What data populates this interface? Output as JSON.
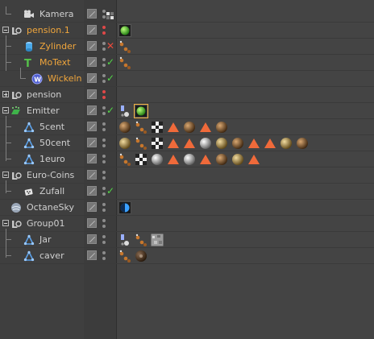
{
  "colors": {
    "orange_label": "#f0a63c",
    "normal_label": "#d0d0d0",
    "red_dot": "#e04848",
    "grey_dot": "#8c8c8c",
    "check": "#52d648",
    "cross": "#e84b3c"
  },
  "rows": [
    {
      "name": "Kamera",
      "icon": "camera-icon",
      "label_color": "normal",
      "vis": [
        "grey",
        "grey"
      ],
      "status": "grid",
      "tags": []
    },
    {
      "name": "pension.1",
      "icon": "null-object-icon",
      "label_color": "orange",
      "vis": [
        "red",
        "red"
      ],
      "status": "",
      "tags": [
        "green-material-icon"
      ]
    },
    {
      "name": "Zylinder",
      "icon": "cylinder-icon",
      "label_color": "orange",
      "vis": [
        "grey",
        "grey"
      ],
      "status": "cross",
      "tags": [
        "texture-dots-icon"
      ]
    },
    {
      "name": "MoText",
      "icon": "motext-icon",
      "label_color": "orange",
      "vis": [
        "grey",
        "grey"
      ],
      "status": "check",
      "tags": [
        "texture-dots-icon"
      ]
    },
    {
      "name": "Wickeln",
      "icon": "wrap-deformer-icon",
      "label_color": "orange",
      "vis": [
        "grey",
        "grey"
      ],
      "status": "check",
      "tags": []
    },
    {
      "name": "pension",
      "icon": "null-object-icon",
      "label_color": "normal",
      "vis": [
        "red",
        "red"
      ],
      "status": "",
      "tags": []
    },
    {
      "name": "Emitter",
      "icon": "emitter-icon",
      "label_color": "normal",
      "vis": [
        "grey",
        "grey"
      ],
      "status": "check",
      "tags": [
        "particle-icon",
        "green-material-icon"
      ]
    },
    {
      "name": "5cent",
      "icon": "cloner-icon",
      "label_color": "normal",
      "vis": [
        "grey",
        "grey"
      ],
      "status": "",
      "tags": [
        "brown-sphere-icon",
        "texture-dots-icon",
        "checker-icon",
        "orange-triangle-icon",
        "brown-sphere-icon",
        "orange-triangle-icon",
        "brown-sphere-icon"
      ]
    },
    {
      "name": "50cent",
      "icon": "cloner-icon",
      "label_color": "normal",
      "vis": [
        "grey",
        "grey"
      ],
      "status": "",
      "tags": [
        "gold-sphere-icon",
        "texture-dots-icon",
        "checker-icon",
        "orange-triangle-icon",
        "orange-triangle-icon",
        "silver-sphere-icon",
        "gold-sphere-icon",
        "brown-sphere-icon",
        "orange-triangle-icon",
        "orange-triangle-icon",
        "gold-sphere-icon",
        "brown-sphere-icon"
      ]
    },
    {
      "name": "1euro",
      "icon": "cloner-icon",
      "label_color": "normal",
      "vis": [
        "grey",
        "grey"
      ],
      "status": "",
      "tags": [
        "texture-dots-icon",
        "checker-icon",
        "silver-sphere-icon",
        "orange-triangle-icon",
        "silver-sphere-icon",
        "orange-triangle-icon",
        "brown-sphere-icon",
        "gold-sphere-icon",
        "orange-triangle-icon"
      ]
    },
    {
      "name": "Euro-Coins",
      "icon": "null-object-icon",
      "label_color": "normal",
      "vis": [
        "grey",
        "grey"
      ],
      "status": "",
      "tags": []
    },
    {
      "name": "Zufall",
      "icon": "random-effector-icon",
      "label_color": "normal",
      "vis": [
        "grey",
        "grey"
      ],
      "status": "check",
      "tags": []
    },
    {
      "name": "OctaneSky",
      "icon": "sky-icon",
      "label_color": "normal",
      "vis": [
        "grey",
        "grey"
      ],
      "status": "",
      "tags": [
        "octane-environment-icon"
      ]
    },
    {
      "name": "Group01",
      "icon": "null-object-icon",
      "label_color": "normal",
      "vis": [
        "grey",
        "grey"
      ],
      "status": "",
      "tags": []
    },
    {
      "name": "Jar",
      "icon": "cloner-icon",
      "label_color": "normal",
      "vis": [
        "grey",
        "grey"
      ],
      "status": "",
      "tags": [
        "particle-icon",
        "texture-dots-icon",
        "noise-texture-icon"
      ]
    },
    {
      "name": "caver",
      "icon": "cloner-icon",
      "label_color": "normal",
      "vis": [
        "grey",
        "grey"
      ],
      "status": "",
      "tags": [
        "texture-dots-icon",
        "dark-brown-sphere-icon"
      ]
    }
  ]
}
